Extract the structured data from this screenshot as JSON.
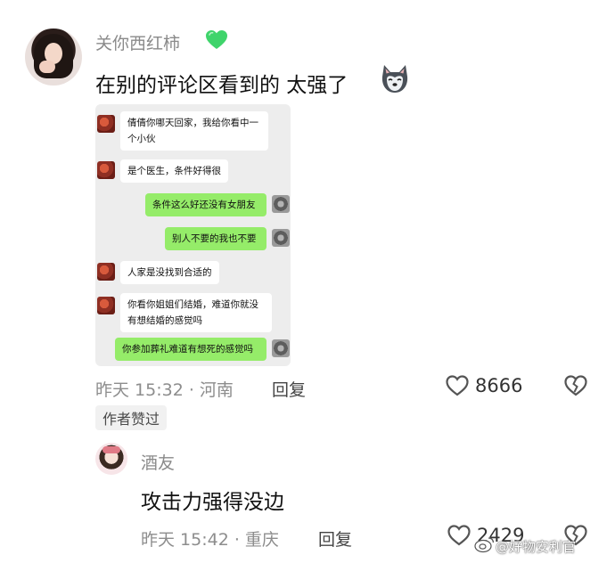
{
  "main_comment": {
    "username": "关你西红柿",
    "text": "在别的评论区看到的 太强了",
    "time_location": "昨天 15:32 · 河南",
    "reply_label": "回复",
    "like_count": "8666",
    "author_liked": "作者赞过"
  },
  "chat": {
    "messages": [
      {
        "side": "in",
        "text": "倩倩你哪天回家，我给你看中一个小伙"
      },
      {
        "side": "in",
        "text": "是个医生，条件好得很"
      },
      {
        "side": "out",
        "text": "条件这么好还没有女朋友"
      },
      {
        "side": "out",
        "text": "别人不要的我也不要"
      },
      {
        "side": "in",
        "text": "人家是没找到合适的"
      },
      {
        "side": "in",
        "text": "你看你姐姐们结婚，难道你就没有想结婚的感觉吗"
      },
      {
        "side": "out",
        "text": "你参加葬礼难道有想死的感觉吗"
      }
    ]
  },
  "reply_comment": {
    "username": "酒友",
    "text": "攻击力强得没边",
    "time_location": "昨天 15:42 · 重庆",
    "reply_label": "回复",
    "like_count": "2429"
  },
  "watermark": "@好物安利官",
  "colors": {
    "bubble_out": "#95ec69",
    "heart": "#3fd46b",
    "meta": "#8d8d8d"
  }
}
